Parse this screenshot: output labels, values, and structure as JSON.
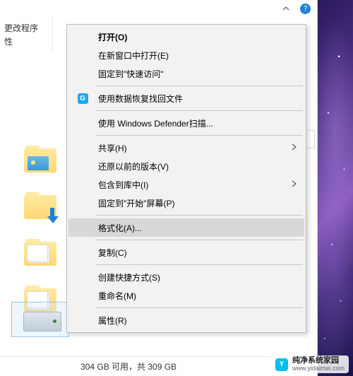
{
  "topbar": {
    "help_tooltip": "?"
  },
  "ribbon": {
    "row1": "更改程序",
    "row2": "性"
  },
  "status": {
    "text": "304 GB 可用，共 309 GB"
  },
  "context_menu": {
    "items": [
      {
        "label": "打开(O)",
        "bold": true
      },
      {
        "label": "在新窗口中打开(E)"
      },
      {
        "label": "固定到\"快速访问\""
      }
    ],
    "recovery_item": {
      "label": "使用数据恢复找回文件",
      "icon_letter": "G"
    },
    "defender_item": {
      "label": "使用 Windows Defender扫描..."
    },
    "share_item": {
      "label": "共享(H)"
    },
    "items2": [
      {
        "label": "还原以前的版本(V)"
      },
      {
        "label": "包含到库中(I)",
        "submenu": true
      },
      {
        "label": "固定到\"开始\"屏幕(P)"
      }
    ],
    "format_item": {
      "label": "格式化(A)..."
    },
    "copy_item": {
      "label": "复制(C)"
    },
    "items3": [
      {
        "label": "创建快捷方式(S)"
      },
      {
        "label": "重命名(M)"
      }
    ],
    "props_item": {
      "label": "属性(R)"
    }
  },
  "watermark": {
    "title": "纯净系统家园",
    "url": "www.yidaimei.com",
    "logo_letter": "Y"
  }
}
